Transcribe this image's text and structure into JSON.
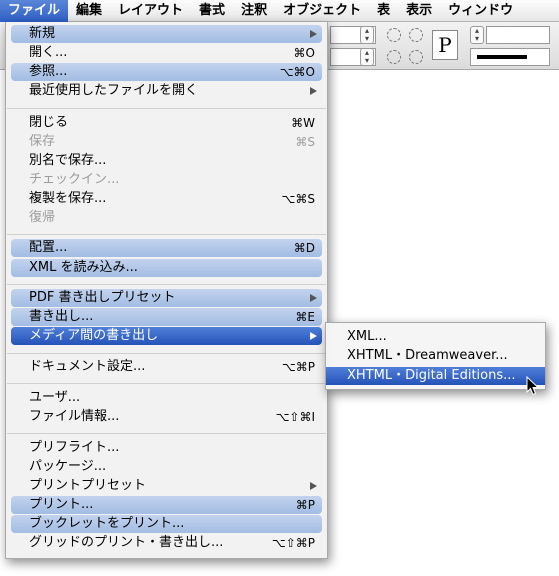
{
  "menubar": {
    "items": [
      "ファイル",
      "編集",
      "レイアウト",
      "書式",
      "注釈",
      "オブジェクト",
      "表",
      "表示",
      "ウィンドウ"
    ],
    "active_index": 0
  },
  "toolbar": {
    "paragraph_glyph": "P"
  },
  "file_menu": {
    "items": [
      {
        "label": "新規",
        "shortcut": "",
        "submenu": true,
        "state": "highlighted"
      },
      {
        "label": "開く...",
        "shortcut": "⌘O",
        "submenu": false,
        "state": "normal"
      },
      {
        "label": "参照...",
        "shortcut": "⌥⌘O",
        "submenu": false,
        "state": "highlighted"
      },
      {
        "label": "最近使用したファイルを開く",
        "shortcut": "",
        "submenu": true,
        "state": "normal"
      },
      {
        "label": "閉じる",
        "shortcut": "⌘W",
        "submenu": false,
        "state": "normal"
      },
      {
        "label": "保存",
        "shortcut": "⌘S",
        "submenu": false,
        "state": "disabled"
      },
      {
        "label": "別名で保存...",
        "shortcut": "",
        "submenu": false,
        "state": "normal"
      },
      {
        "label": "チェックイン...",
        "shortcut": "",
        "submenu": false,
        "state": "disabled"
      },
      {
        "label": "複製を保存...",
        "shortcut": "⌥⌘S",
        "submenu": false,
        "state": "normal"
      },
      {
        "label": "復帰",
        "shortcut": "",
        "submenu": false,
        "state": "disabled"
      },
      {
        "label": "配置...",
        "shortcut": "⌘D",
        "submenu": false,
        "state": "highlighted"
      },
      {
        "label": "XML を読み込み...",
        "shortcut": "",
        "submenu": false,
        "state": "highlighted"
      },
      {
        "label": "PDF 書き出しプリセット",
        "shortcut": "",
        "submenu": true,
        "state": "highlighted"
      },
      {
        "label": "書き出し...",
        "shortcut": "⌘E",
        "submenu": false,
        "state": "highlighted"
      },
      {
        "label": "メディア間の書き出し",
        "shortcut": "",
        "submenu": true,
        "state": "selected"
      },
      {
        "label": "ドキュメント設定...",
        "shortcut": "⌥⌘P",
        "submenu": false,
        "state": "normal"
      },
      {
        "label": "ユーザ...",
        "shortcut": "",
        "submenu": false,
        "state": "normal"
      },
      {
        "label": "ファイル情報...",
        "shortcut": "⌥⇧⌘I",
        "submenu": false,
        "state": "normal"
      },
      {
        "label": "プリフライト...",
        "shortcut": "",
        "submenu": false,
        "state": "normal"
      },
      {
        "label": "パッケージ...",
        "shortcut": "",
        "submenu": false,
        "state": "normal"
      },
      {
        "label": "プリントプリセット",
        "shortcut": "",
        "submenu": true,
        "state": "normal"
      },
      {
        "label": "プリント...",
        "shortcut": "⌘P",
        "submenu": false,
        "state": "highlighted"
      },
      {
        "label": "ブックレットをプリント...",
        "shortcut": "",
        "submenu": false,
        "state": "highlighted"
      },
      {
        "label": "グリッドのプリント・書き出し...",
        "shortcut": "⌥⇧⌘P",
        "submenu": false,
        "state": "normal"
      }
    ]
  },
  "submenu": {
    "items": [
      {
        "label": "XML...",
        "state": "normal"
      },
      {
        "label": "XHTML・Dreamweaver...",
        "state": "normal"
      },
      {
        "label": "XHTML・Digital Editions...",
        "state": "selected"
      }
    ]
  },
  "colors": {
    "selected": "#2e5fc6",
    "highlight": "#b3c8e9",
    "disabled_text": "#9c9c9c"
  }
}
